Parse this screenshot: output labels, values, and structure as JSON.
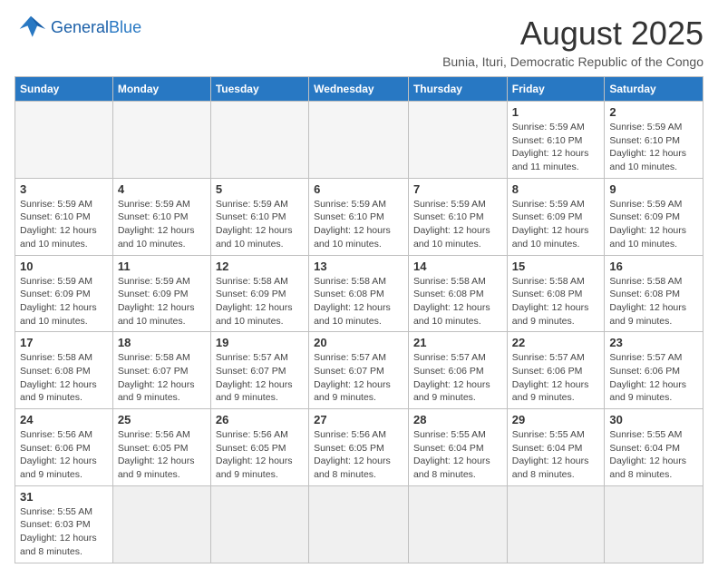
{
  "logo": {
    "line1": "General",
    "line2": "Blue"
  },
  "title": "August 2025",
  "location": "Bunia, Ituri, Democratic Republic of the Congo",
  "days_of_week": [
    "Sunday",
    "Monday",
    "Tuesday",
    "Wednesday",
    "Thursday",
    "Friday",
    "Saturday"
  ],
  "weeks": [
    [
      {
        "day": "",
        "info": ""
      },
      {
        "day": "",
        "info": ""
      },
      {
        "day": "",
        "info": ""
      },
      {
        "day": "",
        "info": ""
      },
      {
        "day": "",
        "info": ""
      },
      {
        "day": "1",
        "info": "Sunrise: 5:59 AM\nSunset: 6:10 PM\nDaylight: 12 hours and 11 minutes."
      },
      {
        "day": "2",
        "info": "Sunrise: 5:59 AM\nSunset: 6:10 PM\nDaylight: 12 hours and 10 minutes."
      }
    ],
    [
      {
        "day": "3",
        "info": "Sunrise: 5:59 AM\nSunset: 6:10 PM\nDaylight: 12 hours and 10 minutes."
      },
      {
        "day": "4",
        "info": "Sunrise: 5:59 AM\nSunset: 6:10 PM\nDaylight: 12 hours and 10 minutes."
      },
      {
        "day": "5",
        "info": "Sunrise: 5:59 AM\nSunset: 6:10 PM\nDaylight: 12 hours and 10 minutes."
      },
      {
        "day": "6",
        "info": "Sunrise: 5:59 AM\nSunset: 6:10 PM\nDaylight: 12 hours and 10 minutes."
      },
      {
        "day": "7",
        "info": "Sunrise: 5:59 AM\nSunset: 6:10 PM\nDaylight: 12 hours and 10 minutes."
      },
      {
        "day": "8",
        "info": "Sunrise: 5:59 AM\nSunset: 6:09 PM\nDaylight: 12 hours and 10 minutes."
      },
      {
        "day": "9",
        "info": "Sunrise: 5:59 AM\nSunset: 6:09 PM\nDaylight: 12 hours and 10 minutes."
      }
    ],
    [
      {
        "day": "10",
        "info": "Sunrise: 5:59 AM\nSunset: 6:09 PM\nDaylight: 12 hours and 10 minutes."
      },
      {
        "day": "11",
        "info": "Sunrise: 5:59 AM\nSunset: 6:09 PM\nDaylight: 12 hours and 10 minutes."
      },
      {
        "day": "12",
        "info": "Sunrise: 5:58 AM\nSunset: 6:09 PM\nDaylight: 12 hours and 10 minutes."
      },
      {
        "day": "13",
        "info": "Sunrise: 5:58 AM\nSunset: 6:08 PM\nDaylight: 12 hours and 10 minutes."
      },
      {
        "day": "14",
        "info": "Sunrise: 5:58 AM\nSunset: 6:08 PM\nDaylight: 12 hours and 10 minutes."
      },
      {
        "day": "15",
        "info": "Sunrise: 5:58 AM\nSunset: 6:08 PM\nDaylight: 12 hours and 9 minutes."
      },
      {
        "day": "16",
        "info": "Sunrise: 5:58 AM\nSunset: 6:08 PM\nDaylight: 12 hours and 9 minutes."
      }
    ],
    [
      {
        "day": "17",
        "info": "Sunrise: 5:58 AM\nSunset: 6:08 PM\nDaylight: 12 hours and 9 minutes."
      },
      {
        "day": "18",
        "info": "Sunrise: 5:58 AM\nSunset: 6:07 PM\nDaylight: 12 hours and 9 minutes."
      },
      {
        "day": "19",
        "info": "Sunrise: 5:57 AM\nSunset: 6:07 PM\nDaylight: 12 hours and 9 minutes."
      },
      {
        "day": "20",
        "info": "Sunrise: 5:57 AM\nSunset: 6:07 PM\nDaylight: 12 hours and 9 minutes."
      },
      {
        "day": "21",
        "info": "Sunrise: 5:57 AM\nSunset: 6:06 PM\nDaylight: 12 hours and 9 minutes."
      },
      {
        "day": "22",
        "info": "Sunrise: 5:57 AM\nSunset: 6:06 PM\nDaylight: 12 hours and 9 minutes."
      },
      {
        "day": "23",
        "info": "Sunrise: 5:57 AM\nSunset: 6:06 PM\nDaylight: 12 hours and 9 minutes."
      }
    ],
    [
      {
        "day": "24",
        "info": "Sunrise: 5:56 AM\nSunset: 6:06 PM\nDaylight: 12 hours and 9 minutes."
      },
      {
        "day": "25",
        "info": "Sunrise: 5:56 AM\nSunset: 6:05 PM\nDaylight: 12 hours and 9 minutes."
      },
      {
        "day": "26",
        "info": "Sunrise: 5:56 AM\nSunset: 6:05 PM\nDaylight: 12 hours and 9 minutes."
      },
      {
        "day": "27",
        "info": "Sunrise: 5:56 AM\nSunset: 6:05 PM\nDaylight: 12 hours and 8 minutes."
      },
      {
        "day": "28",
        "info": "Sunrise: 5:55 AM\nSunset: 6:04 PM\nDaylight: 12 hours and 8 minutes."
      },
      {
        "day": "29",
        "info": "Sunrise: 5:55 AM\nSunset: 6:04 PM\nDaylight: 12 hours and 8 minutes."
      },
      {
        "day": "30",
        "info": "Sunrise: 5:55 AM\nSunset: 6:04 PM\nDaylight: 12 hours and 8 minutes."
      }
    ],
    [
      {
        "day": "31",
        "info": "Sunrise: 5:55 AM\nSunset: 6:03 PM\nDaylight: 12 hours and 8 minutes."
      },
      {
        "day": "",
        "info": ""
      },
      {
        "day": "",
        "info": ""
      },
      {
        "day": "",
        "info": ""
      },
      {
        "day": "",
        "info": ""
      },
      {
        "day": "",
        "info": ""
      },
      {
        "day": "",
        "info": ""
      }
    ]
  ]
}
